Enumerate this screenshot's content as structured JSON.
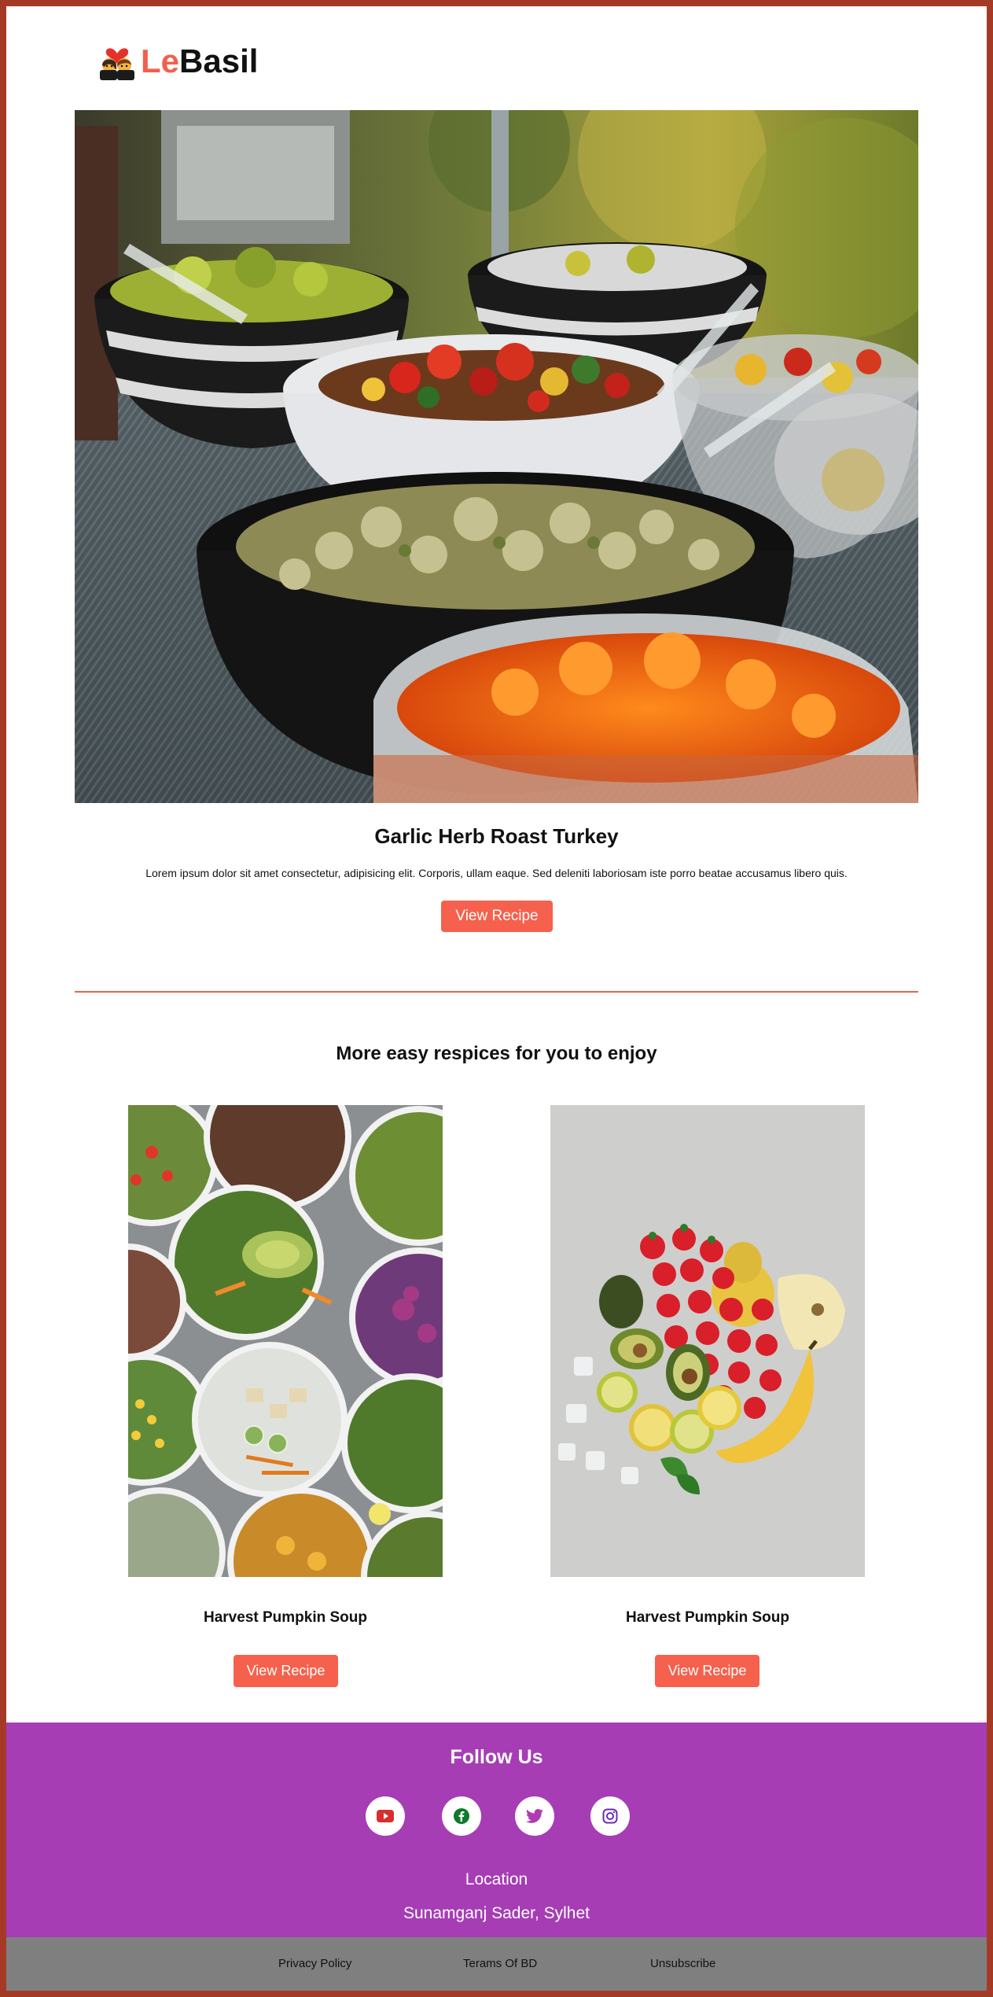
{
  "header": {
    "logo_part1": "Le",
    "logo_part2": "Basil",
    "logo_icon": "couple-heart-icon"
  },
  "hero": {
    "image": "salad-buffet-photo",
    "title": "Garlic Herb Roast Turkey",
    "description": "Lorem ipsum dolor sit amet consectetur, adipisicing elit. Corporis, ullam eaque. Sed deleniti laboriosam iste porro beatae accusamus libero quis.",
    "button_label": "View Recipe"
  },
  "more": {
    "title": "More easy respices for you to enjoy",
    "cards": [
      {
        "image": "salad-bowls-photo",
        "title": "Harvest Pumpkin Soup",
        "button_label": "View Recipe"
      },
      {
        "image": "fruit-platter-photo",
        "title": "Harvest Pumpkin Soup",
        "button_label": "View Recipe"
      }
    ]
  },
  "footer": {
    "follow_title": "Follow Us",
    "social": [
      {
        "icon": "youtube-icon",
        "color": "#d62f2f"
      },
      {
        "icon": "facebook-icon",
        "color": "#0e7a2b"
      },
      {
        "icon": "twitter-icon",
        "color": "#b03ab4"
      },
      {
        "icon": "instagram-icon",
        "color": "#6a2bb2"
      }
    ],
    "location_title": "Location",
    "location_address": "Sunamganj Sader, Sylhet",
    "links": [
      "Privacy Policy",
      "Terams Of BD",
      "Unsubscribe"
    ]
  },
  "colors": {
    "accent": "#f5614c",
    "footer_bg": "#a63db5",
    "bottom_bar": "#7f7f7f",
    "frame": "#a43a26"
  }
}
